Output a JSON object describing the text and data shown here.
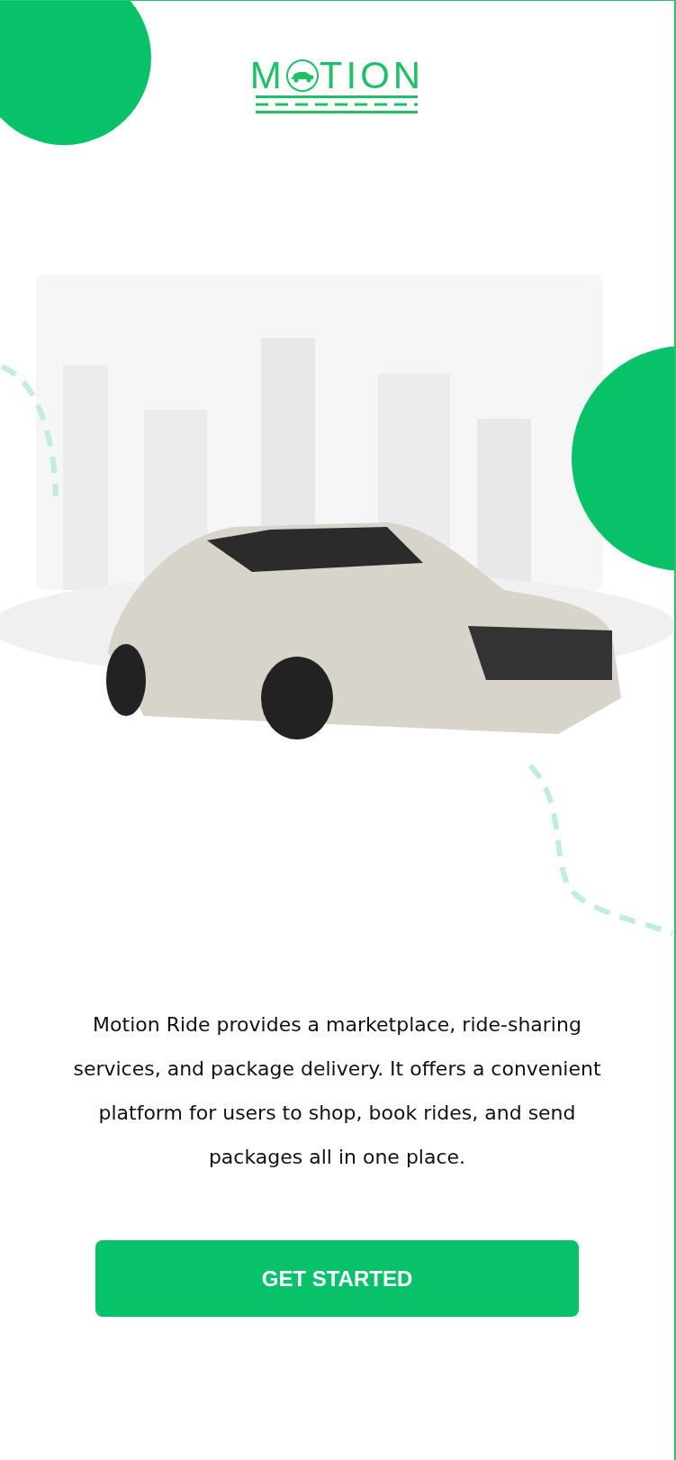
{
  "logo": {
    "text_before": "M",
    "text_after": "TION"
  },
  "description": "Motion Ride provides a marketplace, ride-sharing services, and package delivery. It offers a convenient platform for users to shop, book rides, and send packages all in one place.",
  "button": {
    "label": "GET STARTED"
  }
}
